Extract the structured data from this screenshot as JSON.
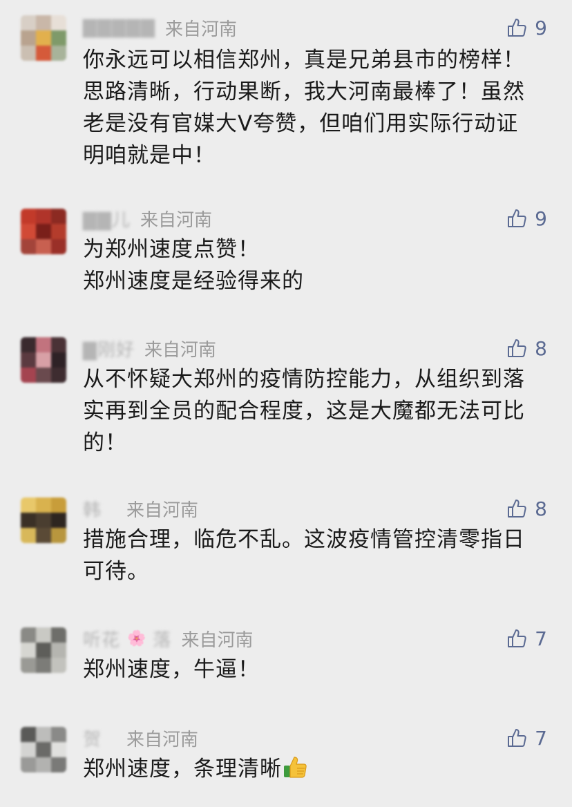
{
  "comments": [
    {
      "nickname": "▇▇▇▇▇",
      "region": "来自河南",
      "likes": "9",
      "text_lines": [
        "你永远可以相信郑州，真是兄弟县市的榜样！",
        "思路清晰，行动果断，我大河南最棒了！虽然",
        "老是没有官媒大V夸赞，但咱们用实际行动证",
        "明咱就是中！"
      ],
      "avatar_colors": [
        "#d8cfc6",
        "#c9b7a8",
        "#e7dfd7",
        "#b9a38f",
        "#e2b04d",
        "#7f9a6a",
        "#cbbfb2",
        "#d55a3a",
        "#a8b39a"
      ]
    },
    {
      "nickname": "▇▇儿",
      "region": "来自河南",
      "likes": "9",
      "text_lines": [
        "为郑州速度点赞！",
        "郑州速度是经验得来的"
      ],
      "avatar_colors": [
        "#c23a2a",
        "#b0342a",
        "#8c2a22",
        "#d14a36",
        "#7a1f1a",
        "#b43c2c",
        "#a3443a",
        "#c86050",
        "#9a3028"
      ]
    },
    {
      "nickname": "▇刚好",
      "region": "来自河南",
      "likes": "8",
      "text_lines": [
        "从不怀疑大郑州的疫情防控能力，从组织到落",
        "实再到全员的配合程度，这是大魔都无法可比",
        "的！"
      ],
      "avatar_colors": [
        "#3a2a2e",
        "#c2737e",
        "#4a3236",
        "#5b3a40",
        "#d8a0a6",
        "#2e2226",
        "#a44450",
        "#6a4a4e",
        "#3e2c30"
      ]
    },
    {
      "nickname": "韩",
      "region": "来自河南",
      "likes": "8",
      "text_lines": [
        "措施合理，临危不乱。这波疫情管控清零指日",
        "可待。"
      ],
      "avatar_colors": [
        "#e8c86a",
        "#d9b24e",
        "#c89d3a",
        "#3a3026",
        "#4a3e30",
        "#2e2620",
        "#d8b85a",
        "#5a4a36",
        "#b8963e"
      ]
    },
    {
      "nickname": "听花",
      "flower": "🌸",
      "nickname_suffix": "落",
      "region": "来自河南",
      "likes": "7",
      "text_lines": [
        "郑州速度，牛逼！"
      ],
      "avatar_colors": [
        "#8a8a86",
        "#c9c9c4",
        "#6e6e6a",
        "#d6d6d1",
        "#5e5e5a",
        "#b5b5b0",
        "#9a9a95",
        "#7c7c78",
        "#c2c2bd"
      ]
    },
    {
      "nickname": "贺",
      "region": "来自河南",
      "likes": "7",
      "text_lines": [
        "郑州速度，条理清晰"
      ],
      "has_thumb_emoji": true,
      "avatar_colors": [
        "#5a5a58",
        "#bdbdbb",
        "#8a8a88",
        "#d4d4d2",
        "#6a6a68",
        "#e0e0de",
        "#9a9a98",
        "#b2b2b0",
        "#7a7a78"
      ]
    }
  ]
}
